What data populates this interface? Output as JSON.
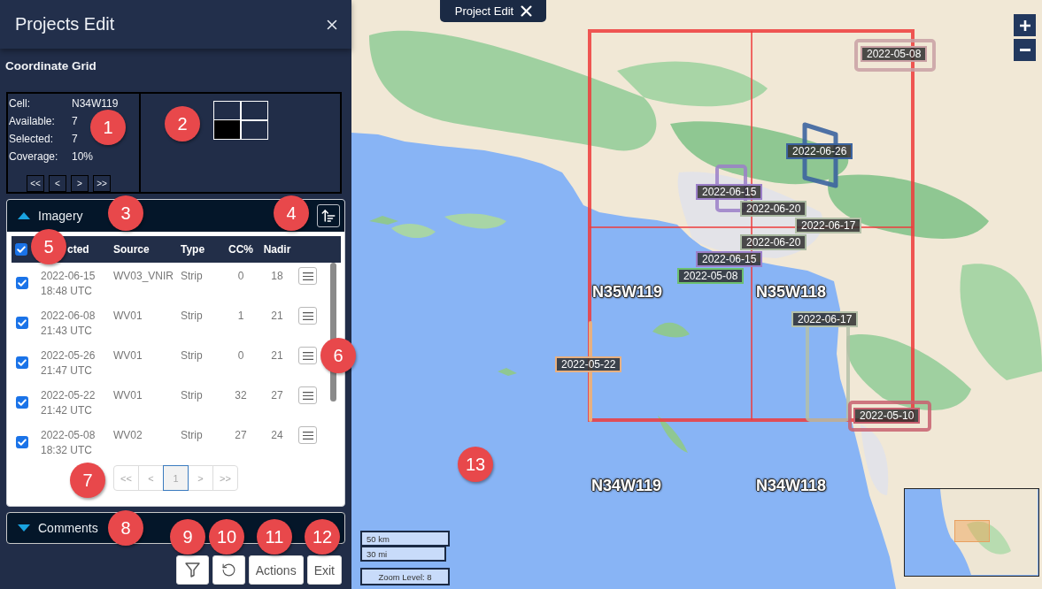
{
  "panel": {
    "title": "Projects Edit"
  },
  "coordinate_grid": {
    "title": "Coordinate Grid",
    "fields": [
      {
        "label": "Cell:",
        "value": "N34W119"
      },
      {
        "label": "Available:",
        "value": "7"
      },
      {
        "label": "Selected:",
        "value": "7"
      },
      {
        "label": "Coverage:",
        "value": "10%"
      }
    ],
    "nav_buttons": [
      "<<",
      "<",
      ">",
      ">>"
    ],
    "cells": [
      {
        "selected": false
      },
      {
        "selected": false
      },
      {
        "selected": true
      },
      {
        "selected": false
      }
    ]
  },
  "imagery": {
    "title": "Imagery",
    "expanded": true,
    "select_all": true,
    "columns": [
      "cted",
      "Source",
      "Type",
      "CC%",
      "Nadir"
    ],
    "rows": [
      {
        "checked": true,
        "datetime": "2022-06-15 18:48 UTC",
        "source": "WV03_VNIR",
        "type": "Strip",
        "cc": "0",
        "nadir": "18"
      },
      {
        "checked": true,
        "datetime": "2022-06-08 21:43 UTC",
        "source": "WV01",
        "type": "Strip",
        "cc": "1",
        "nadir": "21"
      },
      {
        "checked": true,
        "datetime": "2022-05-26 21:47 UTC",
        "source": "WV01",
        "type": "Strip",
        "cc": "0",
        "nadir": "21"
      },
      {
        "checked": true,
        "datetime": "2022-05-22 21:42 UTC",
        "source": "WV01",
        "type": "Strip",
        "cc": "32",
        "nadir": "27"
      },
      {
        "checked": true,
        "datetime": "2022-05-08 18:32 UTC",
        "source": "WV02",
        "type": "Strip",
        "cc": "27",
        "nadir": "24"
      }
    ],
    "pagination": [
      {
        "label": "<<",
        "selected": false
      },
      {
        "label": "<",
        "selected": false
      },
      {
        "label": "1",
        "selected": true
      },
      {
        "label": ">",
        "selected": false
      },
      {
        "label": ">>",
        "selected": false
      }
    ]
  },
  "comments": {
    "title": "Comments",
    "expanded": false
  },
  "footer_buttons": [
    {
      "kind": "filter"
    },
    {
      "kind": "reset"
    },
    {
      "kind": "text",
      "label": "Actions"
    },
    {
      "kind": "text",
      "label": "Exit"
    }
  ],
  "map": {
    "tab": {
      "label": "Project Edit"
    },
    "cell_labels": [
      "N35W119",
      "N35W118",
      "N34W119",
      "N34W118"
    ],
    "footprints": [
      {
        "date": "2022-05-08",
        "color": "#c9a0a4"
      },
      {
        "date": "2022-06-26",
        "color": "#3c64a0"
      },
      {
        "date": "2022-06-15",
        "color": "#9b7fc8"
      },
      {
        "date": "2022-06-20",
        "color": "#a8b8a0"
      },
      {
        "date": "2022-06-17",
        "color": "#b4c0a8"
      },
      {
        "date": "2022-06-20",
        "color": "#a8b8a0"
      },
      {
        "date": "2022-06-15",
        "color": "#9b7fc8"
      },
      {
        "date": "2022-05-08",
        "color": "#6cc070"
      },
      {
        "date": "2022-06-17",
        "color": "#b4c0a8"
      },
      {
        "date": "2022-05-22",
        "color": "#e8b080"
      },
      {
        "date": "2022-05-10",
        "color": "#c86070"
      }
    ],
    "scale": {
      "metric": "50 km",
      "imperial": "30 mi"
    },
    "zoom_level": "Zoom Level: 8"
  },
  "callouts": [
    "1",
    "2",
    "3",
    "4",
    "5",
    "6",
    "7",
    "8",
    "9",
    "10",
    "11",
    "12",
    "13"
  ]
}
